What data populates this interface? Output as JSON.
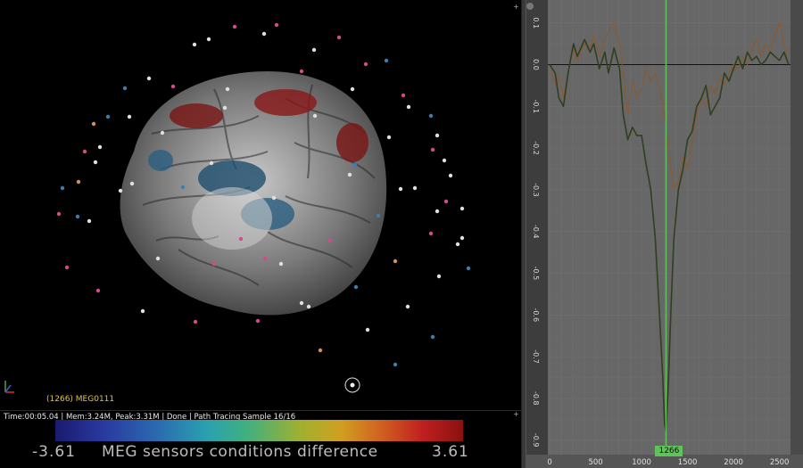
{
  "viewport": {
    "object_label": "(1266) MEG0111",
    "status_text": "Time:00:05.04 | Mem:3.24M, Peak:3.31M | Done | Path Tracing Sample 16/16",
    "colorbar": {
      "min": "-3.61",
      "max": "3.61",
      "title": "MEG sensors conditions difference"
    }
  },
  "graph": {
    "current_frame": "1266",
    "colors": {
      "series_dark": "#2f3f1f",
      "series_orange": "#8a5a30",
      "cursor": "#5fc25a",
      "bg": "#676767"
    },
    "chart_data": {
      "type": "line",
      "x_ticks": [
        "0",
        "500",
        "1000",
        "1500",
        "2000",
        "2500"
      ],
      "y_ticks": [
        "0.1",
        "0.0",
        "-0.1",
        "-0.2",
        "-0.3",
        "-0.4",
        "-0.5",
        "-0.6",
        "-0.7",
        "-0.8",
        "-0.9"
      ],
      "xlim": [
        -20,
        2620
      ],
      "ylim": [
        -0.935,
        0.155
      ],
      "cursor_x": 1266,
      "series": [
        {
          "x": [
            0,
            60,
            100,
            150,
            200,
            260,
            300,
            380,
            440,
            480,
            540,
            600,
            640,
            700,
            760,
            800,
            850,
            900,
            950,
            1000,
            1050,
            1100,
            1150,
            1200,
            1230,
            1250,
            1266,
            1290,
            1320,
            1350,
            1400,
            1450,
            1500,
            1550,
            1600,
            1650,
            1700,
            1750,
            1800,
            1850,
            1900,
            1950,
            2000,
            2050,
            2100,
            2150,
            2200,
            2250,
            2300,
            2350,
            2400,
            2450,
            2500,
            2550,
            2600
          ],
          "values": [
            0.0,
            -0.02,
            -0.08,
            -0.1,
            -0.02,
            0.05,
            0.02,
            0.06,
            0.03,
            0.05,
            -0.01,
            0.03,
            -0.02,
            0.04,
            -0.01,
            -0.12,
            -0.18,
            -0.15,
            -0.17,
            -0.17,
            -0.24,
            -0.3,
            -0.42,
            -0.62,
            -0.75,
            -0.86,
            -0.88,
            -0.77,
            -0.58,
            -0.42,
            -0.3,
            -0.25,
            -0.18,
            -0.16,
            -0.1,
            -0.08,
            -0.05,
            -0.12,
            -0.1,
            -0.08,
            -0.02,
            -0.04,
            -0.01,
            0.02,
            -0.01,
            0.03,
            0.01,
            0.02,
            0.0,
            0.01,
            0.03,
            0.02,
            0.01,
            0.03,
            0.0
          ]
        },
        {
          "x": [
            0,
            60,
            100,
            150,
            200,
            260,
            300,
            380,
            440,
            480,
            540,
            600,
            640,
            700,
            760,
            800,
            850,
            900,
            950,
            1000,
            1050,
            1100,
            1150,
            1200,
            1250,
            1300,
            1350,
            1400,
            1450,
            1500,
            1550,
            1600,
            1650,
            1700,
            1750,
            1800,
            1850,
            1900,
            1950,
            2000,
            2050,
            2100,
            2150,
            2200,
            2250,
            2300,
            2350,
            2400,
            2450,
            2500,
            2550,
            2600
          ],
          "values": [
            0.0,
            -0.05,
            -0.03,
            -0.08,
            -0.02,
            0.04,
            0.01,
            0.05,
            0.04,
            0.07,
            0.02,
            0.06,
            0.08,
            0.1,
            0.05,
            -0.02,
            -0.12,
            -0.04,
            -0.08,
            -0.06,
            -0.01,
            -0.04,
            -0.02,
            -0.06,
            -0.12,
            -0.22,
            -0.3,
            -0.28,
            -0.22,
            -0.25,
            -0.18,
            -0.12,
            -0.08,
            -0.1,
            -0.05,
            -0.07,
            -0.03,
            -0.05,
            -0.02,
            0.0,
            -0.01,
            0.02,
            0.0,
            0.04,
            0.06,
            0.02,
            0.05,
            0.03,
            0.07,
            0.1,
            0.05,
            0.0
          ]
        }
      ]
    }
  }
}
